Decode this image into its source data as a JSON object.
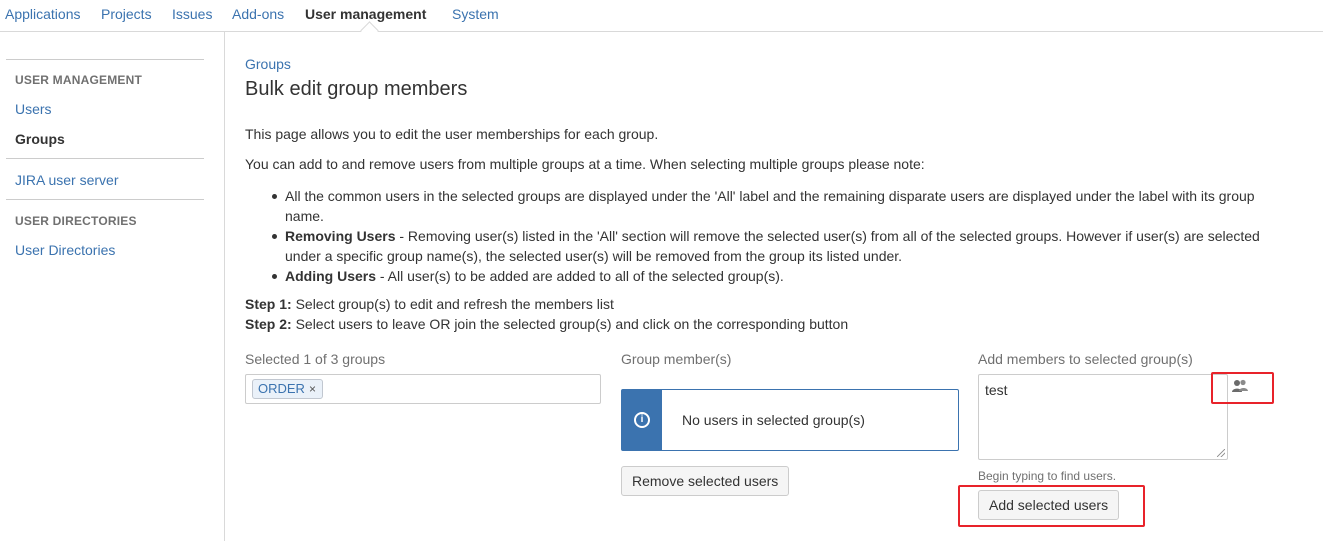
{
  "topnav": {
    "tabs": [
      {
        "label": "Applications"
      },
      {
        "label": "Projects"
      },
      {
        "label": "Issues"
      },
      {
        "label": "Add-ons"
      },
      {
        "label": "User management",
        "active": true
      },
      {
        "label": "System"
      }
    ]
  },
  "sidebar": {
    "sections": [
      {
        "heading": "USER MANAGEMENT",
        "items": [
          {
            "label": "Users"
          },
          {
            "label": "Groups",
            "selected": true
          }
        ]
      },
      {
        "items": [
          {
            "label": "JIRA user server"
          }
        ]
      },
      {
        "heading": "USER DIRECTORIES",
        "items": [
          {
            "label": "User Directories"
          }
        ]
      }
    ]
  },
  "main": {
    "breadcrumb": "Groups",
    "title": "Bulk edit group members",
    "intro": "This page allows you to edit the user memberships for each group.",
    "intro2": "You can add to and remove users from multiple groups at a time. When selecting multiple groups please note:",
    "bullets": [
      {
        "bold": "",
        "text": "All the common users in the selected groups are displayed under the 'All' label and the remaining disparate users are displayed under the label with its group name."
      },
      {
        "bold": "Removing Users",
        "text": " - Removing user(s) listed in the 'All' section will remove the selected user(s) from all of the selected groups. However if user(s) are selected under a specific group name(s), the selected user(s) will be removed from the group its listed under."
      },
      {
        "bold": "Adding Users",
        "text": " - All user(s) to be added are added to all of the selected group(s)."
      }
    ],
    "steps": [
      {
        "bold": "Step 1:",
        "text": " Select group(s) to edit and refresh the members list"
      },
      {
        "bold": "Step 2:",
        "text": " Select users to leave OR join the selected group(s) and click on the corresponding button"
      }
    ],
    "groups_column": {
      "label": "Selected 1 of 3 groups",
      "chips": [
        {
          "label": "ORDER",
          "remove": "×"
        }
      ]
    },
    "members_column": {
      "label": "Group member(s)",
      "info_icon": "info-icon",
      "info_glyph": "i",
      "empty_message": "No users in selected group(s)",
      "remove_button": "Remove selected users"
    },
    "add_column": {
      "label": "Add members to selected group(s)",
      "input_value": "test",
      "picker_icon": "user-group-icon",
      "hint": "Begin typing to find users.",
      "add_button": "Add selected users"
    }
  },
  "colors": {
    "link": "#3b73af",
    "text": "#333333",
    "muted": "#707070",
    "border": "#cccccc",
    "highlight": "#e8232a"
  }
}
